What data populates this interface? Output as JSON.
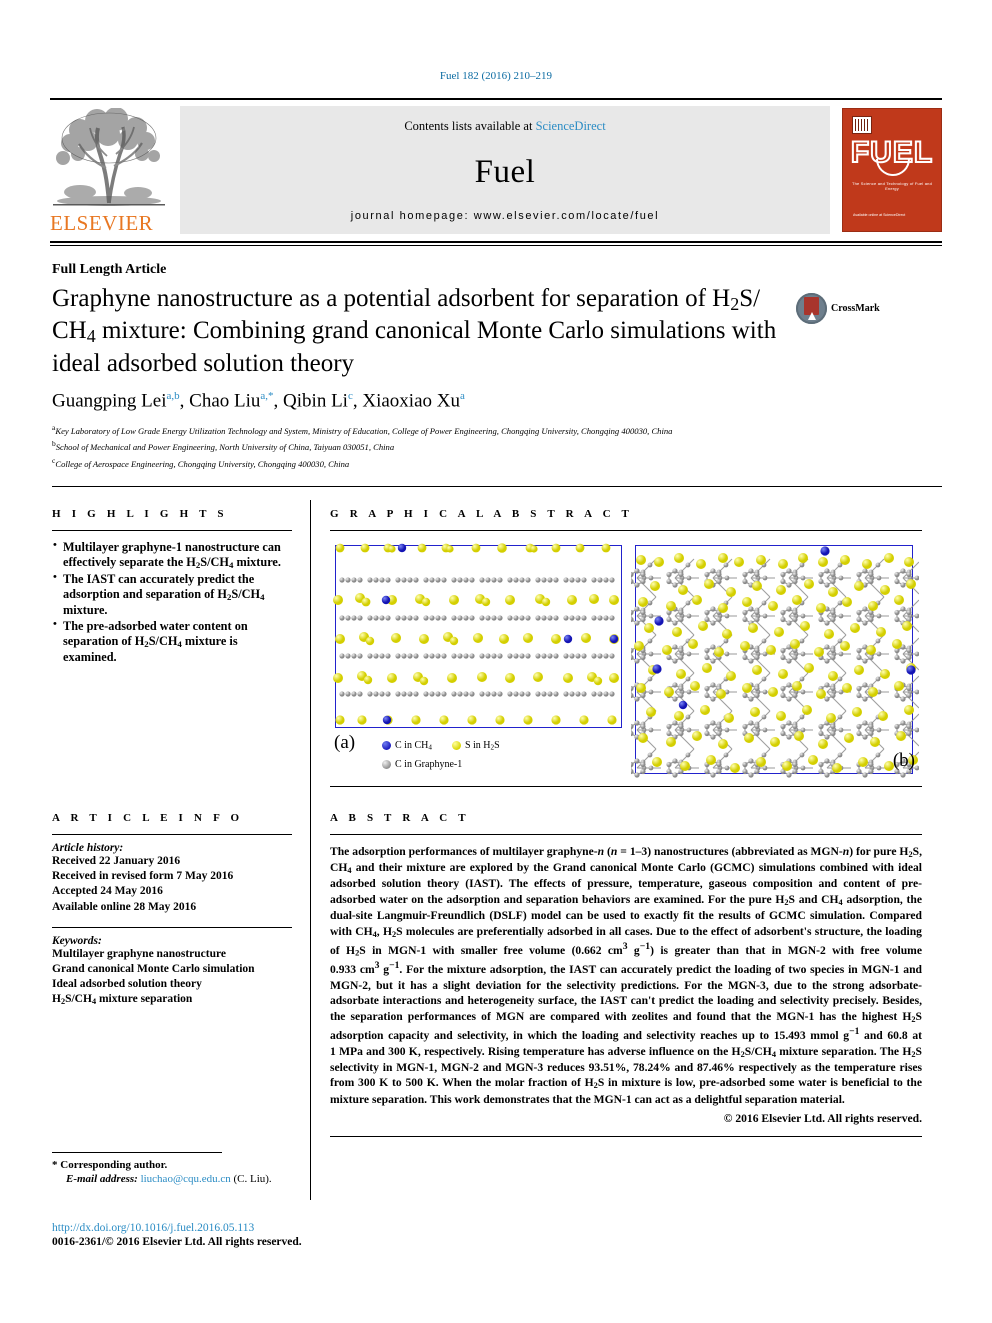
{
  "running_head": "Fuel 182 (2016) 210–219",
  "masthead": {
    "contents_prefix": "Contents lists available at ",
    "sciencedirect": "ScienceDirect",
    "journal_name": "Fuel",
    "homepage": "journal homepage: www.elsevier.com/locate/fuel",
    "publisher_logo_text": "ELSEVIER",
    "cover_title": "FUEL",
    "cover_tagline": "The Science and Technology of Fuel and Energy",
    "cover_footer": "Available online at\nScienceDirect",
    "accent_color": "#2b8cc4",
    "cover_color": "#C0391B",
    "elsevier_orange": "#E87722"
  },
  "article_type": "Full Length Article",
  "title": "Graphyne nanostructure as a potential adsorbent for separation of H2S/CH4 mixture: Combining grand canonical Monte Carlo simulations with ideal adsorbed solution theory",
  "crossmark": {
    "label": "CrossMark"
  },
  "authors": [
    {
      "name": "Guangping Lei",
      "sup": "a,b"
    },
    {
      "name": "Chao Liu",
      "sup": "a,*"
    },
    {
      "name": "Qibin Li",
      "sup": "c"
    },
    {
      "name": "Xiaoxiao Xu",
      "sup": "a"
    }
  ],
  "affiliations": [
    {
      "sup": "a",
      "text": "Key Laboratory of Low Grade Energy Utilization Technology and System, Ministry of Education, College of Power Engineering, Chongqing University, Chongqing 400030, China"
    },
    {
      "sup": "b",
      "text": "School of Mechanical and Power Engineering, North University of China, Taiyuan 030051, China"
    },
    {
      "sup": "c",
      "text": "College of Aerospace Engineering, Chongqing University, Chongqing 400030, China"
    }
  ],
  "highlights": {
    "heading": "H I G H L I G H T S",
    "items": [
      "Multilayer graphyne-1 nanostructure can effectively separate the H2S/CH4 mixture.",
      "The IAST can accurately predict the adsorption and separation of H2S/CH4 mixture.",
      "The pre-adsorbed water content on separation of H2S/CH4 mixture is examined."
    ]
  },
  "graphical_abstract": {
    "heading": "G R A P H I C A L   A B S T R A C T",
    "panel_a_label": "(a)",
    "panel_b_label": "(b)",
    "legend": [
      {
        "color": "#1b1bbe",
        "label": "C in CH4"
      },
      {
        "color": "#d8d400",
        "label": "S in H2S"
      },
      {
        "color": "#8d8d8d",
        "label": "C in Graphyne-1"
      }
    ],
    "cell_border_color": "#2222cc"
  },
  "article_info": {
    "heading": "A R T I C L E   I N F O",
    "history_label": "Article history:",
    "history": [
      "Received 22 January 2016",
      "Received in revised form 7 May 2016",
      "Accepted 24 May 2016",
      "Available online 28 May 2016"
    ],
    "keywords_label": "Keywords:",
    "keywords": [
      "Multilayer graphyne nanostructure",
      "Grand canonical Monte Carlo simulation",
      "Ideal adsorbed solution theory",
      "H2S/CH4 mixture separation"
    ]
  },
  "abstract": {
    "heading": "A B S T R A C T",
    "text": "The adsorption performances of multilayer graphyne-n (n = 1–3) nanostructures (abbreviated as MGN-n) for pure H2S, CH4 and their mixture are explored by the Grand canonical Monte Carlo (GCMC) simulations combined with ideal adsorbed solution theory (IAST). The effects of pressure, temperature, gaseous composition and content of pre-adsorbed water on the adsorption and separation behaviors are examined. For the pure H2S and CH4 adsorption, the dual-site Langmuir-Freundlich (DSLF) model can be used to exactly fit the results of GCMC simulation. Compared with CH4, H2S molecules are preferentially adsorbed in all cases. Due to the effect of adsorbent's structure, the loading of H2S in MGN-1 with smaller free volume (0.662 cm3 g−1) is greater than that in MGN-2 with free volume 0.933 cm3 g−1. For the mixture adsorption, the IAST can accurately predict the loading of two species in MGN-1 and MGN-2, but it has a slight deviation for the selectivity predictions. For the MGN-3, due to the strong adsorbate-adsorbate interactions and heterogeneity surface, the IAST can't predict the loading and selectivity precisely. Besides, the separation performances of MGN are compared with zeolites and found that the MGN-1 has the highest H2S adsorption capacity and selectivity, in which the loading and selectivity reaches up to 15.493 mmol g−1 and 60.8 at 1 MPa and 300 K, respectively. Rising temperature has adverse influence on the H2S/CH4 mixture separation. The H2S selectivity in MGN-1, MGN-2 and MGN-3 reduces 93.51%, 78.24% and 87.46% respectively as the temperature rises from 300 K to 500 K. When the molar fraction of H2S in mixture is low, pre-adsorbed some water is beneficial to the mixture separation. This work demonstrates that the MGN-1 can act as a delightful separation material.",
    "rights": "© 2016 Elsevier Ltd. All rights reserved."
  },
  "footnotes": {
    "corresponding": "* Corresponding author.",
    "email_label": "E-mail address:",
    "email": "liuchao@cqu.edu.cn",
    "email_suffix": "(C. Liu).",
    "doi": "http://dx.doi.org/10.1016/j.fuel.2016.05.113",
    "issn": "0016-2361/© 2016 Elsevier Ltd. All rights reserved."
  }
}
